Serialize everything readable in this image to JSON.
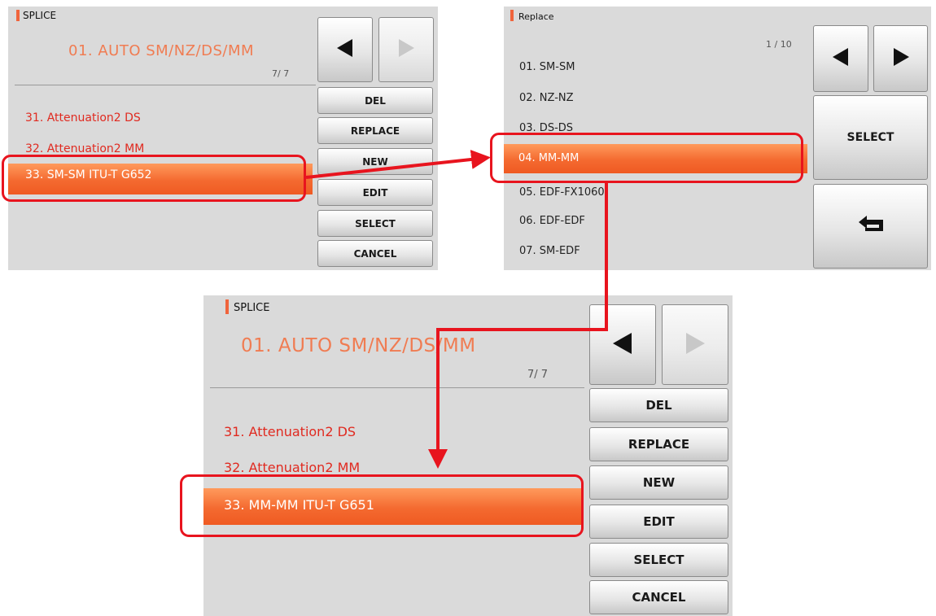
{
  "colors": {
    "accent": "#f0643c",
    "item_text": "#e02a20",
    "highlight": "#e8141e",
    "panel_bg": "#dadada"
  },
  "panel_before": {
    "header": "SPLICE",
    "subtitle": "01. AUTO SM/NZ/DS/MM",
    "pager": "7/ 7",
    "items": [
      "31. Attenuation2 DS",
      "32. Attenuation2 MM"
    ],
    "selected_item": "33. SM-SM ITU-T G652",
    "nav": {
      "prev_icon": "left-arrow-icon",
      "next_icon": "right-arrow-icon (disabled)"
    },
    "buttons": [
      "DEL",
      "REPLACE",
      "NEW",
      "EDIT",
      "SELECT",
      "CANCEL"
    ]
  },
  "panel_replace": {
    "header": "Replace",
    "pager": "1 / 10",
    "items": [
      "01. SM-SM",
      "02. NZ-NZ",
      "03. DS-DS"
    ],
    "selected_item": "04. MM-MM",
    "items_after": [
      "05. EDF-FX1060",
      "06. EDF-EDF",
      "07. SM-EDF"
    ],
    "nav": {
      "prev_icon": "left-arrow-icon",
      "next_icon": "right-arrow-icon"
    },
    "select_label": "SELECT",
    "back_icon": "return-arrow-icon"
  },
  "panel_after": {
    "header": "SPLICE",
    "subtitle": "01. AUTO SM/NZ/DS/MM",
    "pager": "7/ 7",
    "items": [
      "31. Attenuation2 DS",
      "32. Attenuation2 MM"
    ],
    "selected_item": "33. MM-MM ITU-T G651",
    "nav": {
      "prev_icon": "left-arrow-icon",
      "next_icon": "right-arrow-icon (disabled)"
    },
    "buttons": [
      "DEL",
      "REPLACE",
      "NEW",
      "EDIT",
      "SELECT",
      "CANCEL"
    ]
  }
}
